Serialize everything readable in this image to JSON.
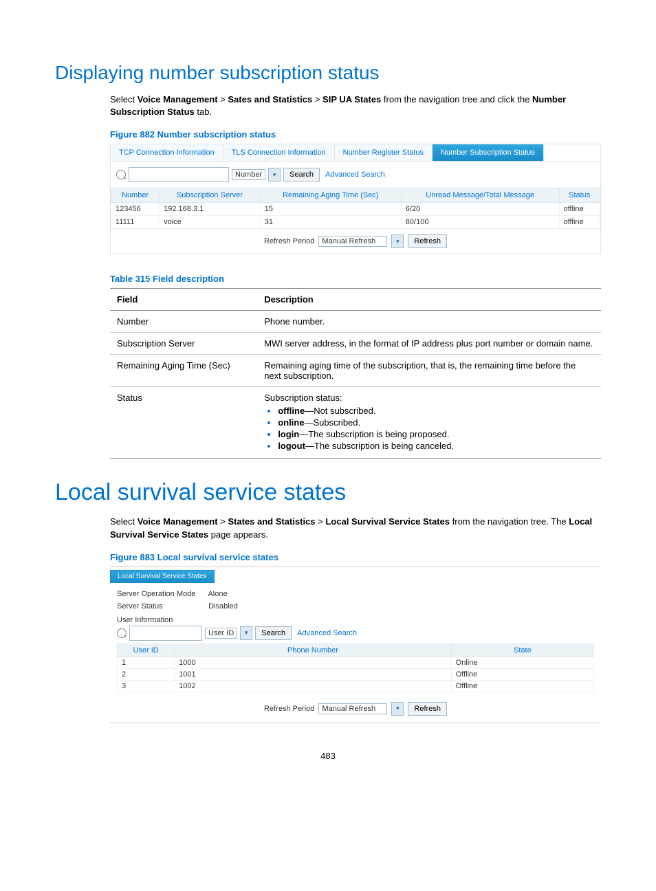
{
  "page_number": "483",
  "section1": {
    "heading": "Displaying number subscription status",
    "intro_pre": "Select ",
    "bc1": "Voice Management",
    "gt": " > ",
    "bc2": "Sates and Statistics",
    "bc3": "SIP UA States",
    "intro_mid": " from the navigation tree and click the ",
    "bc4": "Number Subscription Status",
    "intro_post": " tab.",
    "fig_caption": "Figure 882 Number subscription status"
  },
  "fig882": {
    "tabs": [
      "TCP Connection Information",
      "TLS Connection Information",
      "Number Register Status",
      "Number Subscription Status"
    ],
    "active_tab_index": 3,
    "search_field_option": "Number",
    "search_button": "Search",
    "adv_search": "Advanced Search",
    "columns": [
      "Number",
      "Subscription Server",
      "Remaining Aging Time (Sec)",
      "Unread Message/Total Message",
      "Status"
    ],
    "rows": [
      {
        "c0": "123456",
        "c1": "192.168.3.1",
        "c2": "15",
        "c3": "6/20",
        "c4": "offline"
      },
      {
        "c0": "11111",
        "c1": "voice",
        "c2": "31",
        "c3": "80/100",
        "c4": "offline"
      }
    ],
    "refresh_label": "Refresh Period",
    "refresh_select": "Manual Refresh",
    "refresh_button": "Refresh"
  },
  "table315": {
    "caption": "Table 315 Field description",
    "h_field": "Field",
    "h_desc": "Description",
    "r1f": "Number",
    "r1d": "Phone number.",
    "r2f": "Subscription Server",
    "r2d": "MWI server address, in the format of IP address plus port number or domain name.",
    "r3f": "Remaining Aging Time (Sec)",
    "r3d": "Remaining aging time of the subscription, that is, the remaining time before the next subscription.",
    "r4f": "Status",
    "r4_intro": "Subscription status:",
    "r4_b1a": "offline",
    "r4_b1b": "—Not subscribed.",
    "r4_b2a": "online",
    "r4_b2b": "—Subscribed.",
    "r4_b3a": "login",
    "r4_b3b": "—The subscription is being proposed.",
    "r4_b4a": "logout",
    "r4_b4b": "—The subscription is being canceled."
  },
  "section2": {
    "heading": "Local survival service states",
    "intro_pre": "Select ",
    "bc1": "Voice Management",
    "gt": " > ",
    "bc2": "States and Statistics",
    "bc3": "Local Survival Service States",
    "intro_mid": " from the navigation tree. The ",
    "bc4": "Local Survival Service States",
    "intro_post": " page appears.",
    "fig_caption": "Figure 883 Local survival service states"
  },
  "fig883": {
    "tab": "Local Survival Service States",
    "kv1k": "Server Operation Mode",
    "kv1v": "Alone",
    "kv2k": "Server Status",
    "kv2v": "Disabled",
    "group": "User Information",
    "search_field_option": "User ID",
    "search_button": "Search",
    "adv_search": "Advanced Search",
    "columns": [
      "User ID",
      "Phone Number",
      "State"
    ],
    "rows": [
      {
        "c0": "1",
        "c1": "1000",
        "c2": "Online"
      },
      {
        "c0": "2",
        "c1": "1001",
        "c2": "Offline"
      },
      {
        "c0": "3",
        "c1": "1002",
        "c2": "Offline"
      }
    ],
    "refresh_label": "Refresh Period",
    "refresh_select": "Manual Refresh",
    "refresh_button": "Refresh"
  }
}
